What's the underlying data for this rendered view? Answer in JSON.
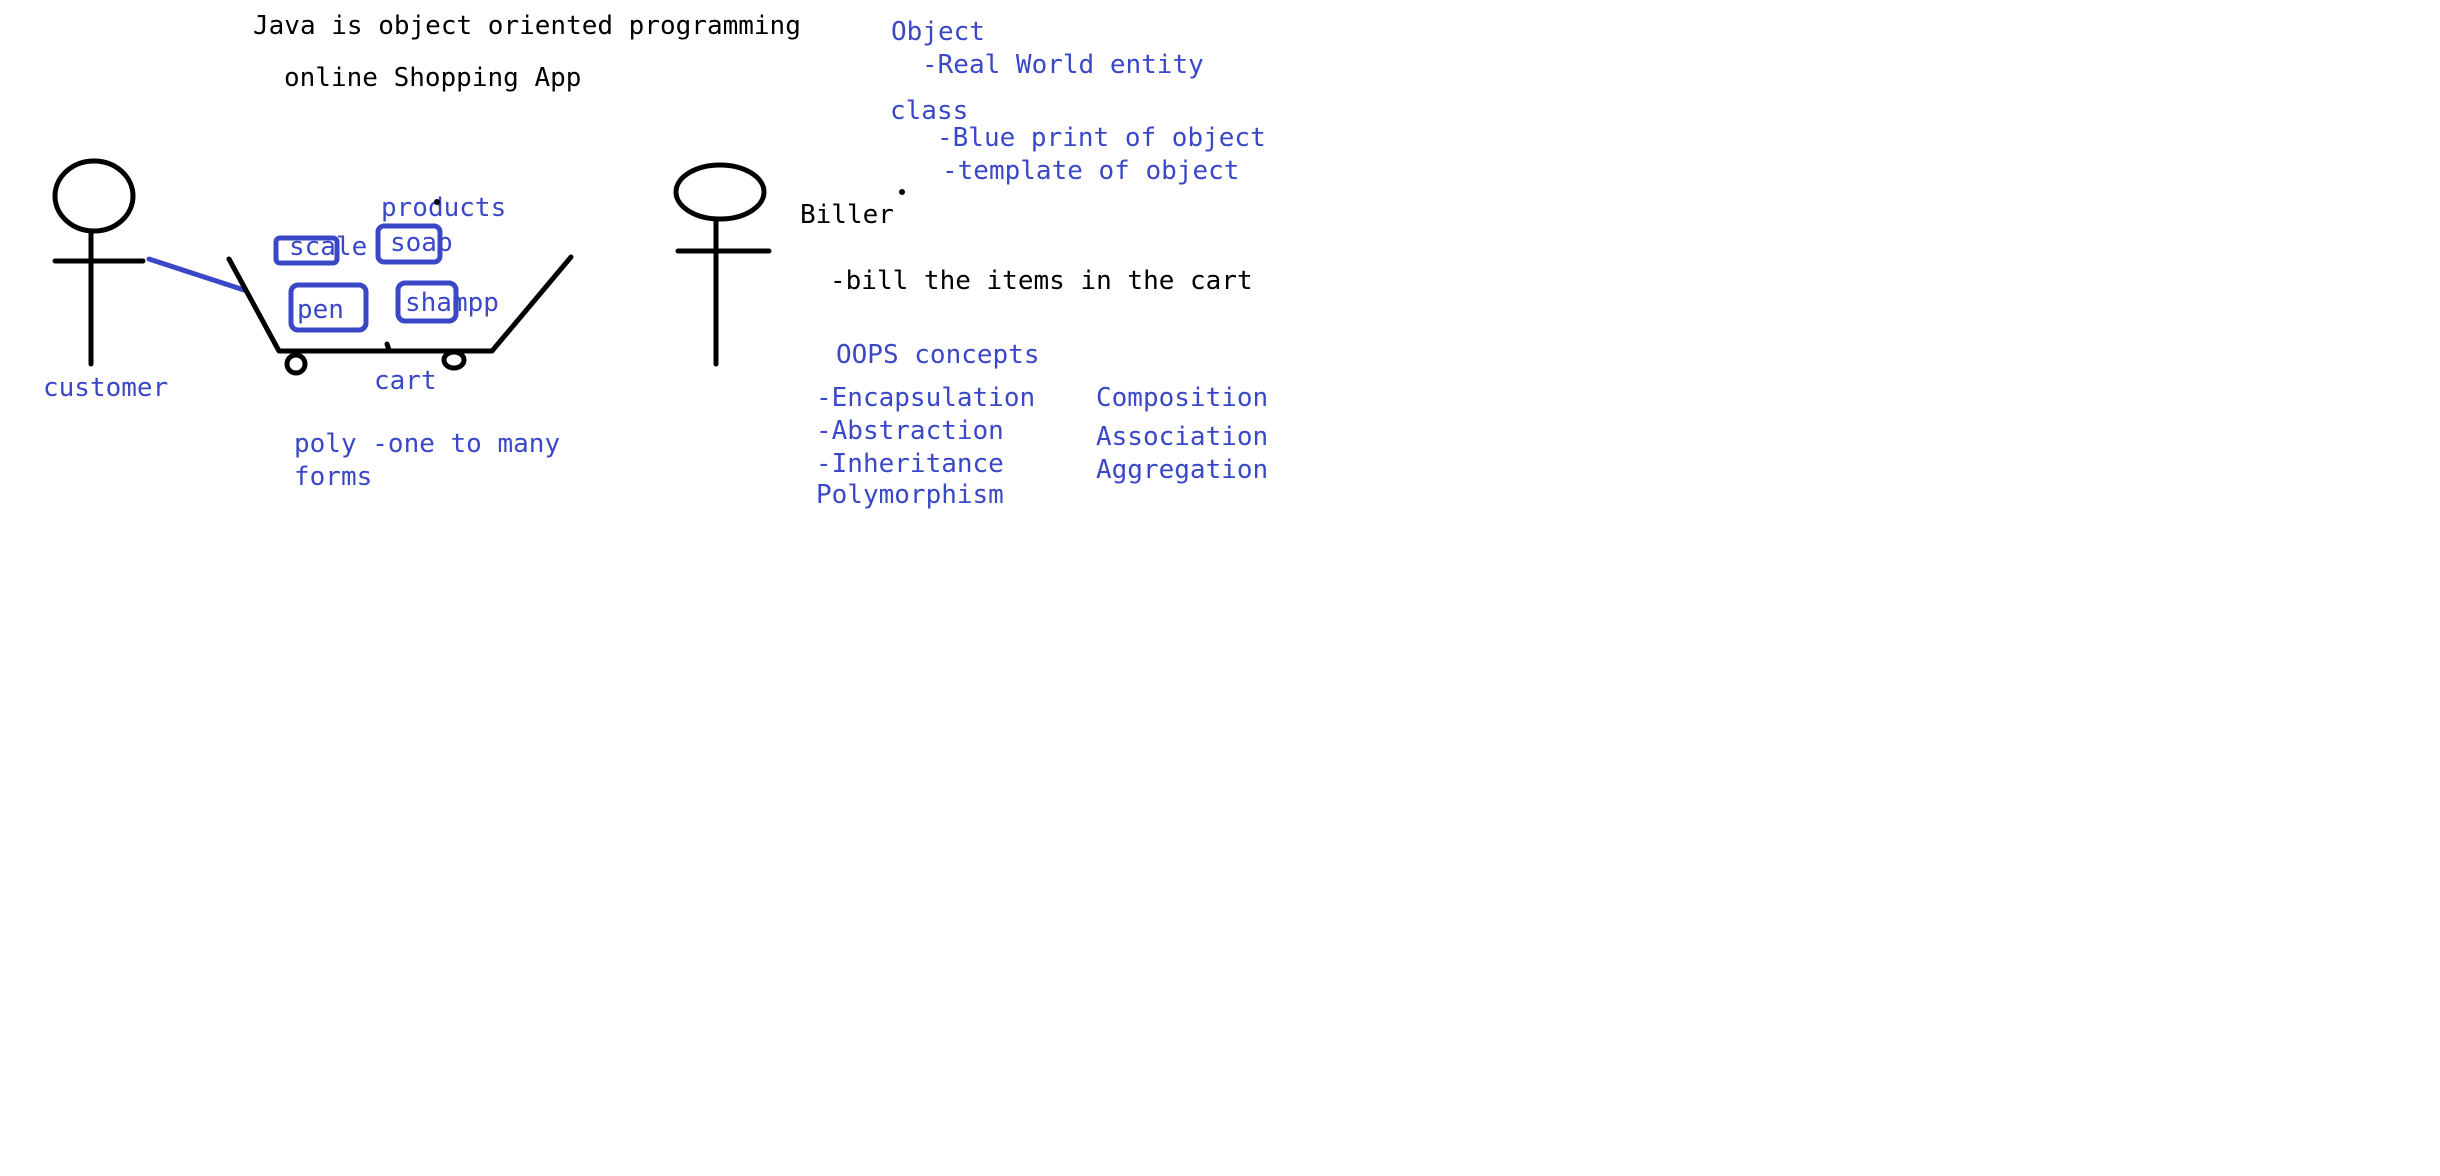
{
  "colors": {
    "ink_black": "#000000",
    "ink_blue": "#3a48c8",
    "background": "#ffffff"
  },
  "header": {
    "title": "Java is object oriented programming",
    "subtitle": "online Shopping App"
  },
  "object_note": {
    "heading": "Object",
    "line1": "-Real World entity"
  },
  "class_note": {
    "heading": "class",
    "line1": "-Blue print of object",
    "line2": "-template of object"
  },
  "diagram": {
    "customer_label": "customer",
    "products_label": "products",
    "cart_label": "cart",
    "items": [
      "scale",
      "soap",
      "pen",
      "shampp"
    ],
    "biller_label": "Biller",
    "biller_note": "-bill the items in the cart"
  },
  "poly_note": {
    "line1": "poly -one to many",
    "line2": "forms"
  },
  "oops": {
    "heading": "OOPS concepts",
    "left": [
      "-Encapsulation",
      "-Abstraction",
      "-Inheritance",
      "Polymorphism"
    ],
    "right": [
      "Composition",
      "Association",
      "Aggregation"
    ]
  }
}
